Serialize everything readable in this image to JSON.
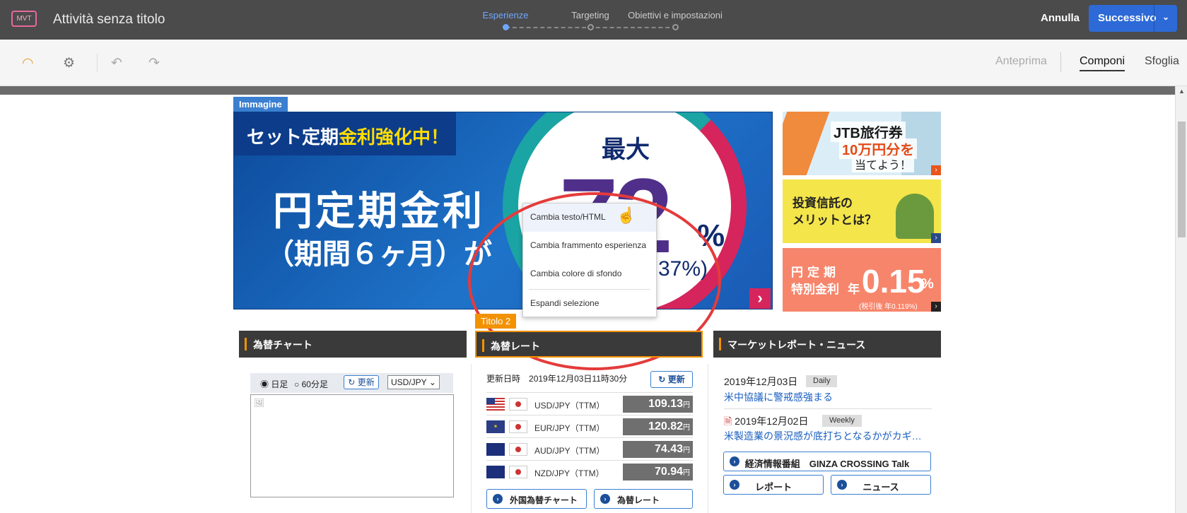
{
  "header": {
    "mvt_badge": "MVT",
    "activity_title": "Attività senza titolo",
    "steps": [
      "Esperienze",
      "Targeting",
      "Obiettivi e impostazioni"
    ],
    "cancel": "Annulla",
    "next": "Successivo"
  },
  "toolbar": {
    "tabs": [
      "Anteprima",
      "Componi",
      "Sfoglia"
    ],
    "selected_tab": "Componi"
  },
  "tags": {
    "image": "Immagine",
    "title2": "Titolo 2"
  },
  "banner": {
    "strip_prefix": "セット定期",
    "strip_highlight": "金利強化中！",
    "main": "円定期金利",
    "sub": "（期間６ヶ月）が",
    "max": "最大",
    "num": "72",
    "pct": "%",
    "paren": "37%)"
  },
  "ads": {
    "ad1": {
      "l1": "JTB旅行券",
      "l2": "10万円分を",
      "l3": "当てよう！"
    },
    "ad2": {
      "l1": "投資信託の",
      "l2": "メリットとは？"
    },
    "ad3": {
      "l1": "円定期",
      "l2": "特別金利",
      "nen": "年",
      "rate": "0.15",
      "pct": "%",
      "fine": "(税引後 年0.119%)"
    }
  },
  "context_menu": {
    "items": [
      "Cambia testo/HTML",
      "Cambia frammento esperienza",
      "Cambia colore di sfondo",
      "Espandi selezione"
    ]
  },
  "sections": {
    "chart": "為替チャート",
    "rates": "為替レート",
    "market": "マーケットレポート・ニュース"
  },
  "chart_panel": {
    "radio1": "日足",
    "radio2": "60分足",
    "update": "更新",
    "pair": "USD/JPY"
  },
  "rates_panel": {
    "updated_label": "更新日時",
    "updated_value": "2019年12月03日11時30分",
    "update": "更新",
    "rows": [
      {
        "pair": "USD/JPY（TTM）",
        "value": "109.13"
      },
      {
        "pair": "EUR/JPY（TTM）",
        "value": "120.82"
      },
      {
        "pair": "AUD/JPY（TTM）",
        "value": "74.43"
      },
      {
        "pair": "NZD/JPY（TTM）",
        "value": "70.94"
      }
    ],
    "unit": "円",
    "link1": "外国為替チャート",
    "link2": "為替レート"
  },
  "market": {
    "news": [
      {
        "date": "2019年12月03日",
        "badge": "Daily",
        "title": "米中協議に警戒感強まる"
      },
      {
        "date": "2019年12月02日",
        "badge": "Weekly",
        "title": "米製造業の景況感が底打ちとなるかがカギ…"
      }
    ],
    "btn_program": "経済情報番組　GINZA CROSSING Talk",
    "btn_report": "レポート",
    "btn_news": "ニュース"
  }
}
